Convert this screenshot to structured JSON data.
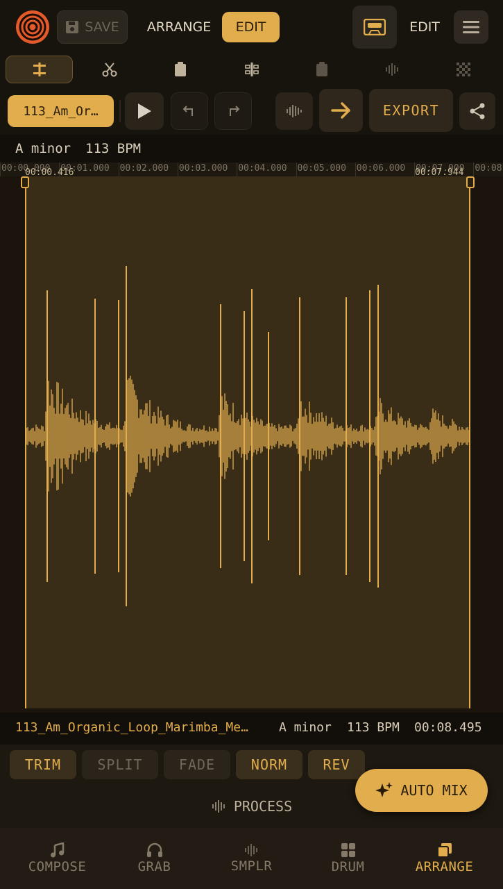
{
  "colors": {
    "accent": "#e2ad4d",
    "background": "#120e09",
    "panel": "#2a241b"
  },
  "topbar": {
    "logo_icon": "vortex-logo-icon",
    "save_label": "SAVE",
    "arrange_label": "ARRANGE",
    "edit_label": "EDIT",
    "edit_right_label": "EDIT"
  },
  "tools": [
    "align-icon",
    "scissors-icon",
    "clipboard-icon",
    "split-icon",
    "clipboard-icon",
    "waveform-icon",
    "grid-icon"
  ],
  "transport": {
    "file_name": "113_Am_Or…",
    "export_label": "EXPORT"
  },
  "info": {
    "key": "A minor",
    "bpm": "113 BPM"
  },
  "ruler": {
    "ticks": [
      "00:00.000",
      "00:01.000",
      "00:02.000",
      "00:03.000",
      "00:04.000",
      "00:05.000",
      "00:06.000",
      "00:07.000",
      "00:08"
    ],
    "sel_start": "00:00.416",
    "sel_end": "00:07.944"
  },
  "footer": {
    "file_name": "113_Am_Organic_Loop_Marimba_Me…",
    "key": "A minor",
    "bpm": "113 BPM",
    "duration": "00:08.495"
  },
  "edit_tools": {
    "trim": "TRIM",
    "split": "SPLIT",
    "fade": "FADE",
    "norm": "NORM",
    "rev": "REV",
    "process": "PROCESS",
    "auto_mix": "AUTO MIX"
  },
  "nav": [
    {
      "label": "COMPOSE",
      "icon": "music-note-icon",
      "active": false
    },
    {
      "label": "GRAB",
      "icon": "headphones-icon",
      "active": false
    },
    {
      "label": "SMPLR",
      "icon": "waveform-icon",
      "active": false
    },
    {
      "label": "DRUM",
      "icon": "grid-icon",
      "active": false
    },
    {
      "label": "ARRANGE",
      "icon": "layers-icon",
      "active": true
    }
  ]
}
